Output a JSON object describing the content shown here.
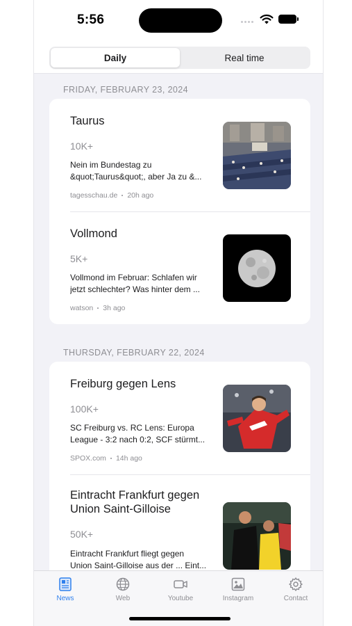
{
  "status_bar": {
    "time": "5:56"
  },
  "segmented": {
    "options": [
      "Daily",
      "Real time"
    ],
    "selected": "Daily"
  },
  "sections": [
    {
      "date": "FRIDAY, FEBRUARY 23, 2024",
      "items": [
        {
          "title": "Taurus",
          "traffic": "10K+",
          "snippet": "Nein im Bundestag zu\n&quot;Taurus&quot;, aber Ja zu &...",
          "source": "tagesschau.de",
          "age": "20h ago",
          "thumb": "parliament-image"
        },
        {
          "title": "Vollmond",
          "traffic": "5K+",
          "snippet": "Vollmond im Februar: Schlafen wir\njetzt schlechter? Was hinter dem ...",
          "source": "watson",
          "age": "3h ago",
          "thumb": "moon-image"
        }
      ]
    },
    {
      "date": "THURSDAY, FEBRUARY 22, 2024",
      "items": [
        {
          "title": "Freiburg gegen Lens",
          "traffic": "100K+",
          "snippet": "SC Freiburg vs. RC Lens: Europa\nLeague - 3:2 nach 0:2, SCF stürmt...",
          "source": "SPOX.com",
          "age": "14h ago",
          "thumb": "football-player-image"
        },
        {
          "title": "Eintracht Frankfurt gegen Union Saint-Gilloise",
          "traffic": "50K+",
          "snippet": "Eintracht Frankfurt fliegt gegen\nUnion Saint-Gilloise aus der ... Eint...",
          "source": "",
          "age": "",
          "thumb": "football-match-image"
        }
      ]
    }
  ],
  "tabbar": {
    "tabs": [
      {
        "label": "News",
        "icon": "newspaper-icon",
        "active": true
      },
      {
        "label": "Web",
        "icon": "globe-icon",
        "active": false
      },
      {
        "label": "Youtube",
        "icon": "video-camera-icon",
        "active": false
      },
      {
        "label": "Instagram",
        "icon": "photo-icon",
        "active": false
      },
      {
        "label": "Contact",
        "icon": "gear-icon",
        "active": false
      }
    ]
  },
  "colors": {
    "accent": "#2f80ed",
    "background": "#f2f2f7",
    "secondary_text": "#8e8e93"
  }
}
